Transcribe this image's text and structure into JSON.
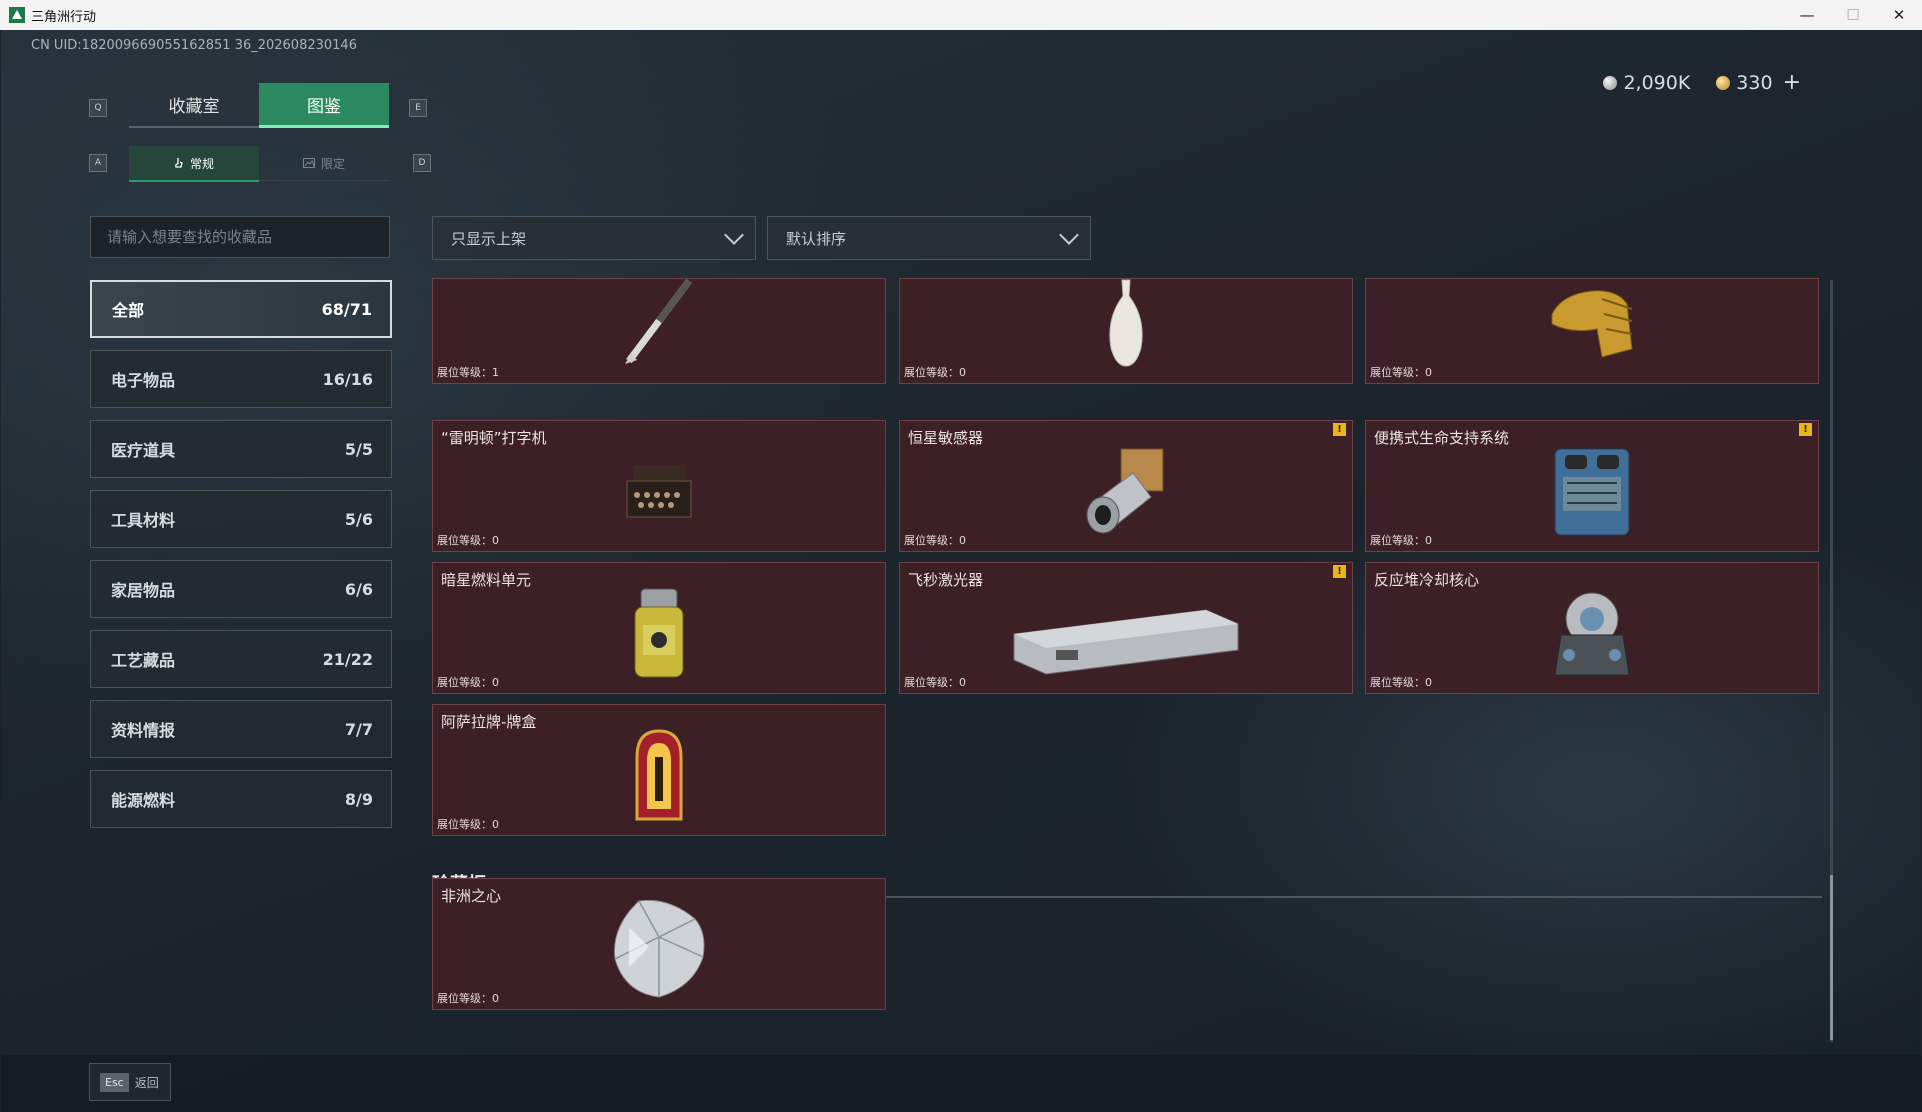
{
  "window": {
    "title": "三角洲行动",
    "minimize": "—",
    "maximize": "☐",
    "close": "✕"
  },
  "uid": "CN UID:182009669055162851 36_202608230146",
  "currency": {
    "silver": "2,090K",
    "gold": "330",
    "add": "+"
  },
  "keys": {
    "prev_tab": "Q",
    "next_tab": "E",
    "prev_sub": "A",
    "next_sub": "D"
  },
  "tabs": [
    {
      "label": "收藏室"
    },
    {
      "label": "图鉴"
    }
  ],
  "subtabs": [
    {
      "label": "常规"
    },
    {
      "label": "限定"
    }
  ],
  "search": {
    "placeholder": "请输入想要查找的收藏品"
  },
  "filters": {
    "display": "只显示上架",
    "sort": "默认排序"
  },
  "categories": [
    {
      "label": "全部",
      "count": "68/71"
    },
    {
      "label": "电子物品",
      "count": "16/16"
    },
    {
      "label": "医疗道具",
      "count": "5/5"
    },
    {
      "label": "工具材料",
      "count": "5/6"
    },
    {
      "label": "家居物品",
      "count": "6/6"
    },
    {
      "label": "工艺藏品",
      "count": "21/22"
    },
    {
      "label": "资料情报",
      "count": "7/7"
    },
    {
      "label": "能源燃料",
      "count": "8/9"
    }
  ],
  "items": [
    {
      "name": "",
      "level": "展位等级：1",
      "icon": "fountain-pen"
    },
    {
      "name": "",
      "level": "展位等级：0",
      "icon": "porcelain-vase"
    },
    {
      "name": "",
      "level": "展位等级：0",
      "icon": "golden-head"
    },
    {
      "name": "“雷明顿”打字机",
      "level": "展位等级：0",
      "icon": "typewriter"
    },
    {
      "name": "恒星敏感器",
      "level": "展位等级：0",
      "icon": "star-sensor",
      "alert": "!"
    },
    {
      "name": "便携式生命支持系统",
      "level": "展位等级：0",
      "icon": "life-support",
      "alert": "!"
    },
    {
      "name": "暗星燃料单元",
      "level": "展位等级：0",
      "icon": "fuel-cell"
    },
    {
      "name": "飞秒激光器",
      "level": "展位等级：0",
      "icon": "laser",
      "alert": "!"
    },
    {
      "name": "反应堆冷却核心",
      "level": "展位等级：0",
      "icon": "reactor-core"
    },
    {
      "name": "阿萨拉牌-牌盒",
      "level": "展位等级：0",
      "icon": "card-box"
    }
  ],
  "treasure": {
    "title": "珍藏柜",
    "items": [
      {
        "name": "非洲之心",
        "level": "展位等级：0",
        "icon": "diamond"
      }
    ]
  },
  "footer": {
    "key": "Esc",
    "label": "返回"
  },
  "colors": {
    "accent": "#2b8a60",
    "card_bg": "#3d2026",
    "alert": "#e8b51a"
  }
}
